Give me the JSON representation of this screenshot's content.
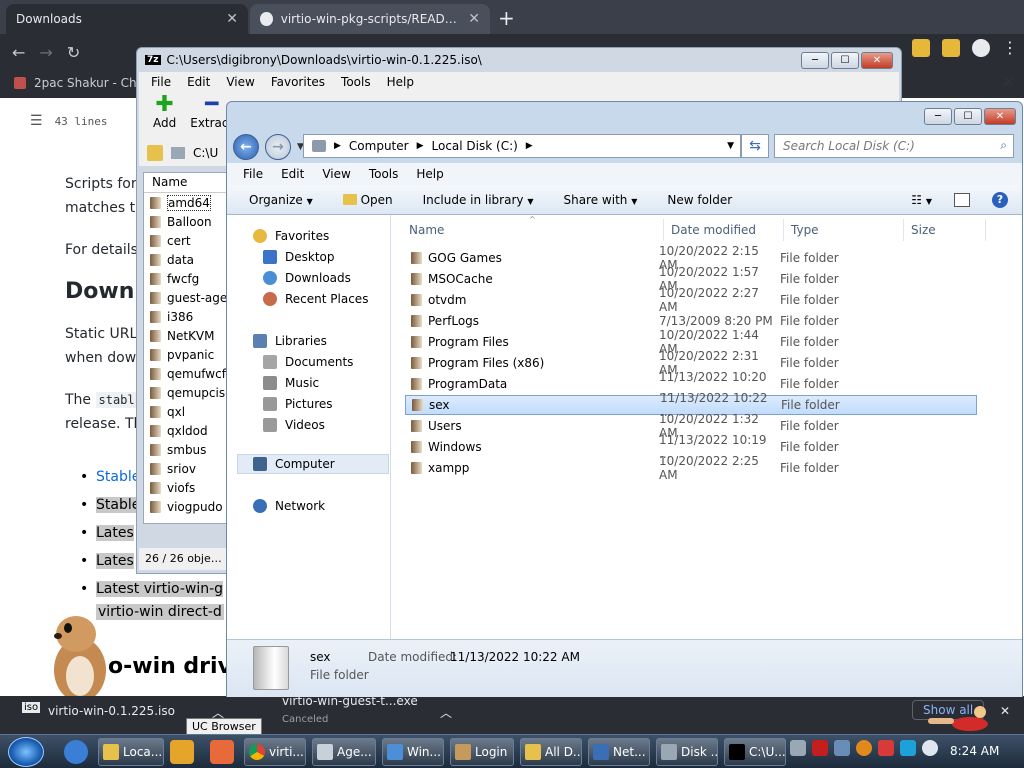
{
  "browser": {
    "tabs": [
      {
        "title": "Downloads"
      },
      {
        "title": "virtio-win-pkg-scripts/README.m"
      }
    ],
    "bookmark": "2pac Shakur - Chro",
    "toolbar": {
      "lines": "43 lines"
    },
    "page": {
      "p1": "Scripts for",
      "p1b": "matches t",
      "p2": "For details",
      "h2": "Downl",
      "p3": "Static URL",
      "p3b": "when dow",
      "p4a": "The",
      "p4code": "stabl",
      "p4b": "release. Th",
      "list": [
        "Stable",
        "Stable",
        "Lates",
        "Lates",
        "Latest virtio-win-g"
      ],
      "after": "virtio-win direct-d",
      "h2b": "o-win drive"
    },
    "downloads": [
      {
        "name": "virtio-win-0.1.225.iso"
      },
      {
        "name": "virtio-win-guest-t...exe",
        "status": "Canceled"
      }
    ],
    "show_all": "Show all",
    "tooltip": "UC Browser"
  },
  "zip": {
    "title": "C:\\Users\\digibrony\\Downloads\\virtio-win-0.1.225.iso\\",
    "menu": [
      "File",
      "Edit",
      "View",
      "Favorites",
      "Tools",
      "Help"
    ],
    "tools": [
      {
        "label": "Add",
        "glyph": "✚"
      },
      {
        "label": "Extract",
        "glyph": "━"
      }
    ],
    "path": "C:\\U",
    "column": "Name",
    "items": [
      "amd64",
      "Balloon",
      "cert",
      "data",
      "fwcfg",
      "guest-agen",
      "i386",
      "NetKVM",
      "pvpanic",
      "qemufwcfg",
      "qemupciserial",
      "qxl",
      "qxldod",
      "smbus",
      "sriov",
      "viofs",
      "viogpudo"
    ],
    "status": "26 / 26 object(s)"
  },
  "explorer": {
    "breadcrumb": [
      "Computer",
      "Local Disk (C:)"
    ],
    "search_placeholder": "Search Local Disk (C:)",
    "menu": [
      "File",
      "Edit",
      "View",
      "Tools",
      "Help"
    ],
    "commands": {
      "organize": "Organize",
      "open": "Open",
      "include": "Include in library",
      "share": "Share with",
      "new_folder": "New folder"
    },
    "nav": {
      "favorites": "Favorites",
      "desktop": "Desktop",
      "downloads": "Downloads",
      "recent": "Recent Places",
      "libraries": "Libraries",
      "documents": "Documents",
      "music": "Music",
      "pictures": "Pictures",
      "videos": "Videos",
      "computer": "Computer",
      "network": "Network"
    },
    "columns": {
      "name": "Name",
      "date": "Date modified",
      "type": "Type",
      "size": "Size"
    },
    "rows": [
      {
        "name": "GOG Games",
        "date": "10/20/2022 2:15 AM",
        "type": "File folder"
      },
      {
        "name": "MSOCache",
        "date": "10/20/2022 1:57 AM",
        "type": "File folder"
      },
      {
        "name": "otvdm",
        "date": "10/20/2022 2:27 AM",
        "type": "File folder"
      },
      {
        "name": "PerfLogs",
        "date": "7/13/2009 8:20 PM",
        "type": "File folder"
      },
      {
        "name": "Program Files",
        "date": "10/20/2022 1:44 AM",
        "type": "File folder"
      },
      {
        "name": "Program Files (x86)",
        "date": "10/20/2022 2:31 AM",
        "type": "File folder"
      },
      {
        "name": "ProgramData",
        "date": "11/13/2022 10:20 ...",
        "type": "File folder"
      },
      {
        "name": "sex",
        "date": "11/13/2022 10:22 ...",
        "type": "File folder"
      },
      {
        "name": "Users",
        "date": "10/20/2022 1:32 AM",
        "type": "File folder"
      },
      {
        "name": "Windows",
        "date": "11/13/2022 10:19 ...",
        "type": "File folder"
      },
      {
        "name": "xampp",
        "date": "10/20/2022 2:25 AM",
        "type": "File folder"
      }
    ],
    "selected": {
      "name": "sex",
      "date_label": "Date modified:",
      "date": "11/13/2022 10:22 AM",
      "type": "File folder"
    }
  },
  "taskbar": {
    "buttons": [
      "Loca...",
      "virti...",
      "Age...",
      "Win...",
      "Login",
      "All D...",
      "Net...",
      "Disk ...",
      "C:\\U..."
    ],
    "clock": "8:24 AM"
  },
  "colors": {
    "selection": "#c1dcfc",
    "taskbar": "#1d2b3b",
    "chrome_dark": "#2a2d34",
    "link": "#0969da"
  }
}
